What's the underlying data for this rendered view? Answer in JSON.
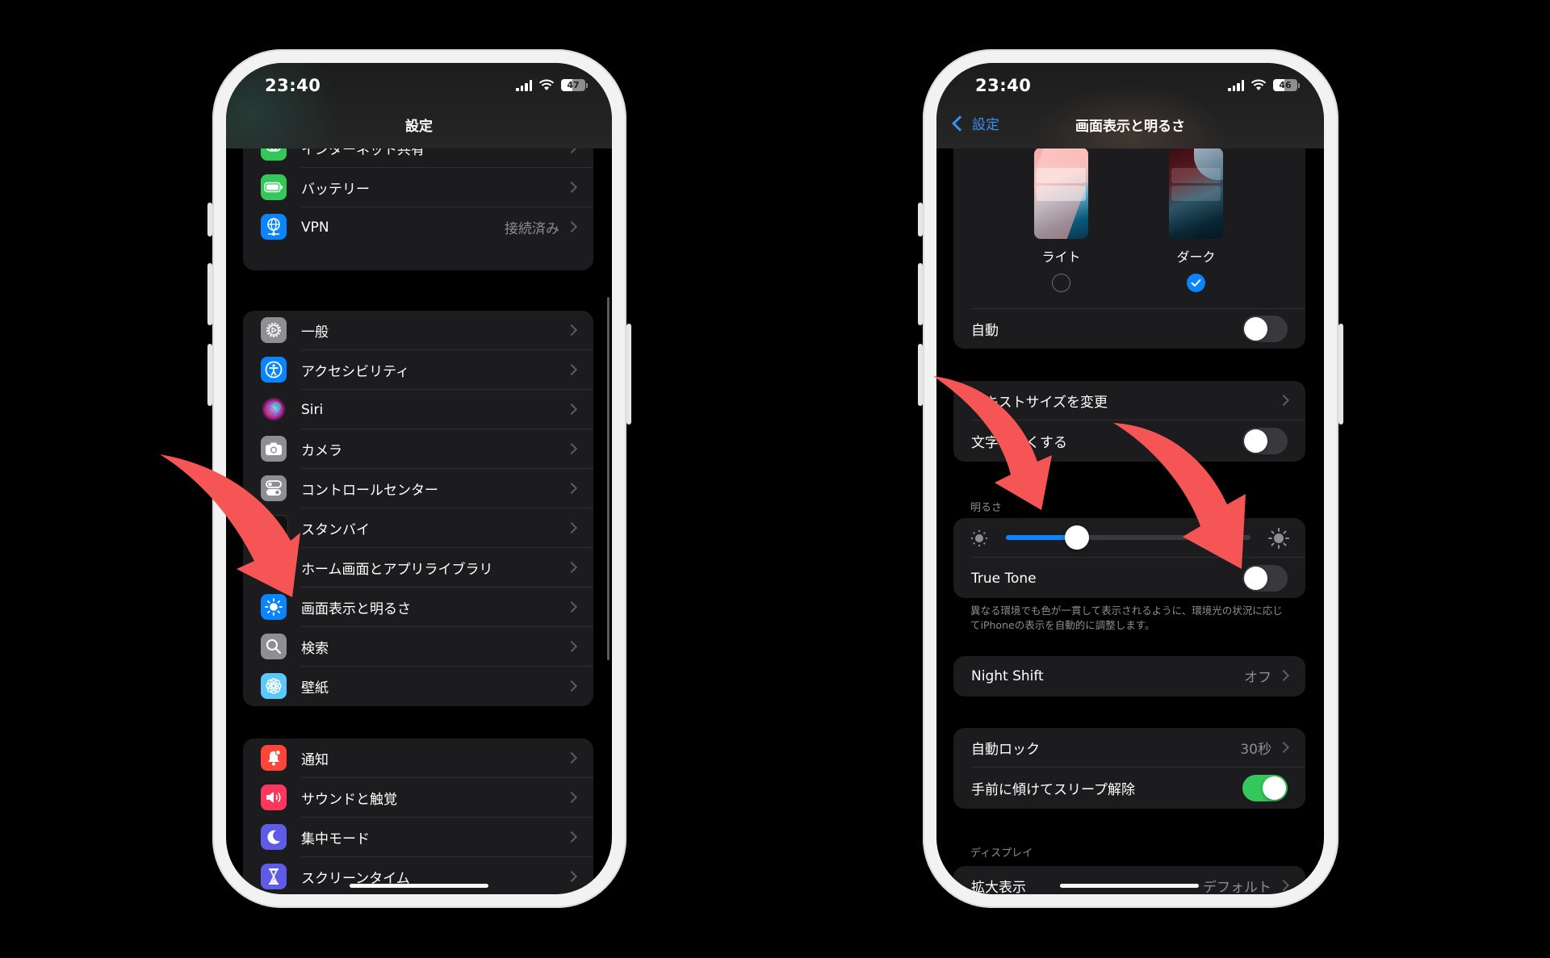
{
  "left_phone": {
    "status": {
      "time": "23:40",
      "battery": "47",
      "battery_level": 0.47
    },
    "nav_title": "設定",
    "groups": [
      {
        "rows": [
          {
            "label": "インターネット共有",
            "icon": "personal-hotspot-icon",
            "icon_color": "#34c759",
            "value": ""
          },
          {
            "label": "バッテリー",
            "icon": "battery-icon",
            "icon_color": "#34c759",
            "value": ""
          },
          {
            "label": "VPN",
            "icon": "vpn-globe-icon",
            "icon_color": "#0a84ff",
            "value": "接続済み"
          }
        ]
      },
      {
        "rows": [
          {
            "label": "一般",
            "icon": "gear-icon",
            "icon_color": "#8e8e93"
          },
          {
            "label": "アクセシビリティ",
            "icon": "accessibility-icon",
            "icon_color": "#0a84ff"
          },
          {
            "label": "Siri",
            "icon": "siri-icon",
            "icon_color": "#2b2b30"
          },
          {
            "label": "カメラ",
            "icon": "camera-icon",
            "icon_color": "#8e8e93"
          },
          {
            "label": "コントロールセンター",
            "icon": "control-center-icon",
            "icon_color": "#8e8e93"
          },
          {
            "label": "スタンバイ",
            "icon": "standby-icon",
            "icon_color": "#111111"
          },
          {
            "label": "ホーム画面とアプリライブラリ",
            "icon": "home-screen-icon",
            "icon_color": "#0a84ff"
          },
          {
            "label": "画面表示と明るさ",
            "icon": "sun-icon",
            "icon_color": "#0a84ff"
          },
          {
            "label": "検索",
            "icon": "search-icon",
            "icon_color": "#8e8e93"
          },
          {
            "label": "壁紙",
            "icon": "wallpaper-flower-icon",
            "icon_color": "#5ac8fa"
          }
        ]
      },
      {
        "rows": [
          {
            "label": "通知",
            "icon": "notification-bell-icon",
            "icon_color": "#ff453a"
          },
          {
            "label": "サウンドと触覚",
            "icon": "speaker-icon",
            "icon_color": "#ff375f"
          },
          {
            "label": "集中モード",
            "icon": "moon-icon",
            "icon_color": "#5e5ce6"
          },
          {
            "label": "スクリーンタイム",
            "icon": "hourglass-icon",
            "icon_color": "#5e5ce6"
          }
        ]
      }
    ]
  },
  "right_phone": {
    "status": {
      "time": "23:40",
      "battery": "46",
      "battery_level": 0.46
    },
    "back_label": "設定",
    "nav_title": "画面表示と明るさ",
    "appearance": {
      "options": [
        {
          "label": "ライト",
          "selected": false
        },
        {
          "label": "ダーク",
          "selected": true
        }
      ],
      "auto_label": "自動",
      "auto_on": false
    },
    "text_group": {
      "text_size_label": "テキストサイズを変更",
      "bold_text_label": "文字を太くする",
      "bold_text_on": false
    },
    "brightness": {
      "header": "明るさ",
      "level": 0.29,
      "true_tone_label": "True Tone",
      "true_tone_on": false,
      "footer": "異なる環境でも色が一貫して表示されるように、環境光の状況に応じてiPhoneの表示を自動的に調整します。"
    },
    "night_shift": {
      "label": "Night Shift",
      "value": "オフ"
    },
    "lock_group": {
      "auto_lock_label": "自動ロック",
      "auto_lock_value": "30秒",
      "raise_to_wake_label": "手前に傾けてスリープ解除",
      "raise_to_wake_on": true
    },
    "display": {
      "header": "ディスプレイ",
      "zoom_label": "拡大表示",
      "zoom_value": "デフォルト"
    }
  },
  "colors": {
    "accent": "#0a84ff",
    "annotation_arrow": "#f65556",
    "toggle_on": "#34c759"
  }
}
